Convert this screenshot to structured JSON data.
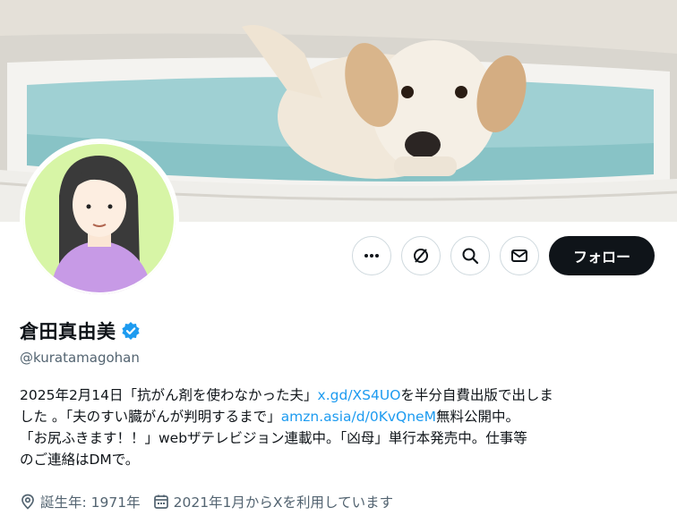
{
  "profile": {
    "display_name": "倉田真由美",
    "handle": "@kuratamagohan",
    "follow_label": "フォロー",
    "bio": {
      "line1_a": "2025年2月14日「抗がん剤を使わなかった夫」",
      "line1_link": "x.gd/XS4UO",
      "line1_b": "を半分自費出版で出しま",
      "line2_a": "した 。「夫のすい臓がんが判明するまで」",
      "line2_link": "amzn.asia/d/0KvQneM",
      "line2_b": "無料公開中。",
      "line3": "「お尻ふきます！！」webザテレビジョン連載中。「凶母」単行本発売中。仕事等",
      "line4": "のご連絡はDMで。"
    },
    "birth": "誕生年: 1971年",
    "joined": "2021年1月からXを利用しています"
  },
  "icons": {
    "more": "more-icon",
    "grok": "grok-icon",
    "search": "search-icon",
    "message": "message-icon",
    "verified": "verified-badge-icon",
    "location": "location-pin-icon",
    "calendar": "calendar-icon"
  },
  "colors": {
    "accent": "#1d9bf0",
    "text": "#0f1419",
    "secondary_text": "#536471",
    "follow_bg": "#0f1419"
  }
}
